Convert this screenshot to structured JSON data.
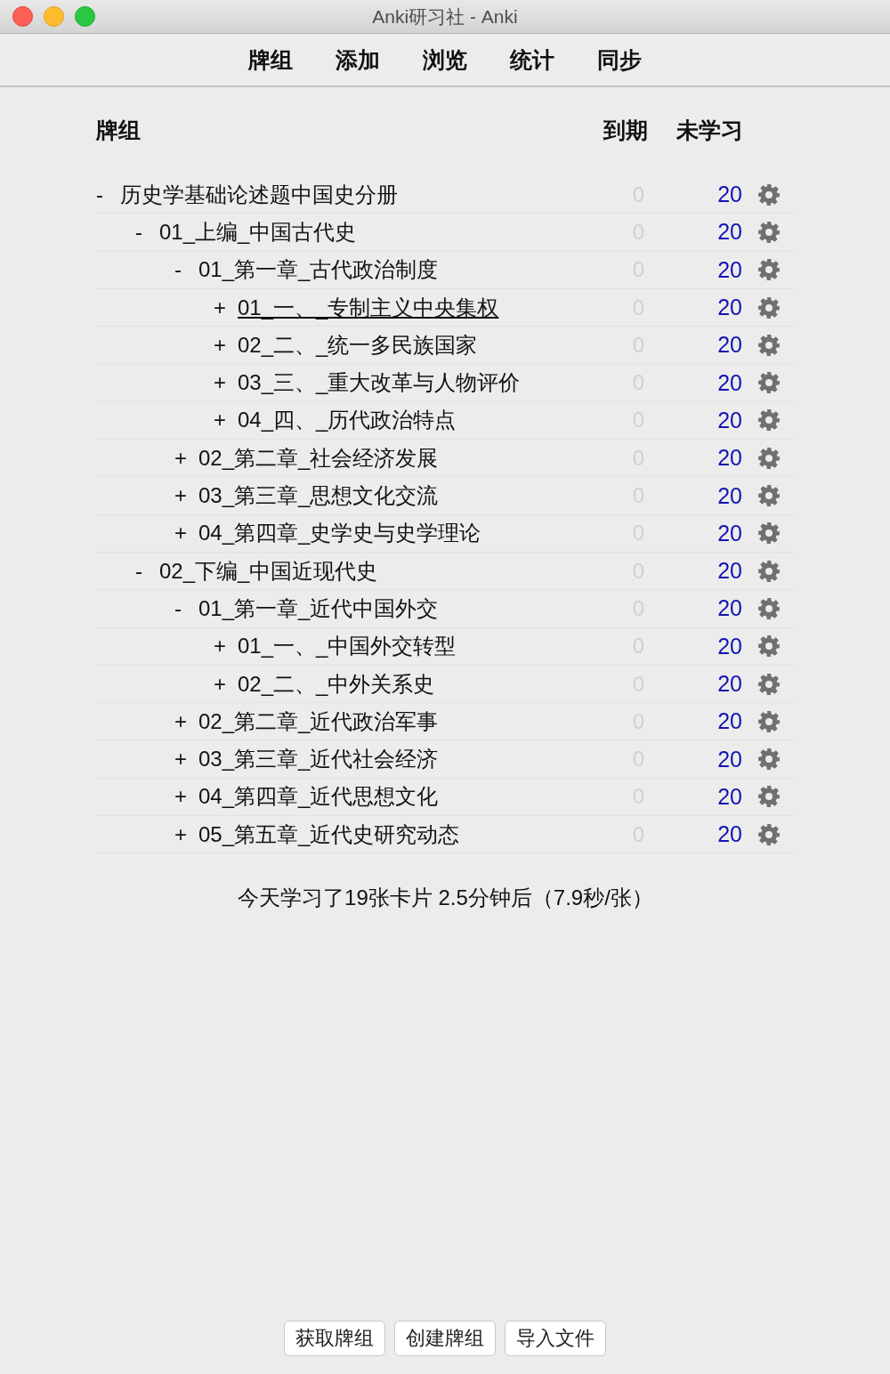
{
  "window": {
    "title": "Anki研习社 - Anki"
  },
  "toolbar": [
    {
      "label": "牌组"
    },
    {
      "label": "添加"
    },
    {
      "label": "浏览"
    },
    {
      "label": "统计"
    },
    {
      "label": "同步"
    }
  ],
  "columns": {
    "deck": "牌组",
    "due": "到期",
    "new": "未学习"
  },
  "decks": [
    {
      "toggle": "-",
      "name": "历史学基础论述题中国史分册",
      "due": "0",
      "new": "20",
      "current": false,
      "children": [
        {
          "toggle": "-",
          "name": "01_上编_中国古代史",
          "due": "0",
          "new": "20",
          "current": false,
          "children": [
            {
              "toggle": "-",
              "name": "01_第一章_古代政治制度",
              "due": "0",
              "new": "20",
              "current": false,
              "children": [
                {
                  "toggle": "+",
                  "name": "01_一、_专制主义中央集权",
                  "due": "0",
                  "new": "20",
                  "current": true
                },
                {
                  "toggle": "+",
                  "name": "02_二、_统一多民族国家",
                  "due": "0",
                  "new": "20",
                  "current": false
                },
                {
                  "toggle": "+",
                  "name": "03_三、_重大改革与人物评价",
                  "due": "0",
                  "new": "20",
                  "current": false
                },
                {
                  "toggle": "+",
                  "name": "04_四、_历代政治特点",
                  "due": "0",
                  "new": "20",
                  "current": false
                }
              ]
            },
            {
              "toggle": "+",
              "name": "02_第二章_社会经济发展",
              "due": "0",
              "new": "20",
              "current": false
            },
            {
              "toggle": "+",
              "name": "03_第三章_思想文化交流",
              "due": "0",
              "new": "20",
              "current": false
            },
            {
              "toggle": "+",
              "name": "04_第四章_史学史与史学理论",
              "due": "0",
              "new": "20",
              "current": false
            }
          ]
        },
        {
          "toggle": "-",
          "name": "02_下编_中国近现代史",
          "due": "0",
          "new": "20",
          "current": false,
          "children": [
            {
              "toggle": "-",
              "name": "01_第一章_近代中国外交",
              "due": "0",
              "new": "20",
              "current": false,
              "children": [
                {
                  "toggle": "+",
                  "name": "01_一、_中国外交转型",
                  "due": "0",
                  "new": "20",
                  "current": false
                },
                {
                  "toggle": "+",
                  "name": "02_二、_中外关系史",
                  "due": "0",
                  "new": "20",
                  "current": false
                }
              ]
            },
            {
              "toggle": "+",
              "name": "02_第二章_近代政治军事",
              "due": "0",
              "new": "20",
              "current": false
            },
            {
              "toggle": "+",
              "name": "03_第三章_近代社会经济",
              "due": "0",
              "new": "20",
              "current": false
            },
            {
              "toggle": "+",
              "name": "04_第四章_近代思想文化",
              "due": "0",
              "new": "20",
              "current": false
            },
            {
              "toggle": "+",
              "name": "05_第五章_近代史研究动态",
              "due": "0",
              "new": "20",
              "current": false
            }
          ]
        }
      ]
    }
  ],
  "summary": "今天学习了19张卡片 2.5分钟后（7.9秒/张）",
  "buttons": [
    {
      "label": "获取牌组"
    },
    {
      "label": "创建牌组"
    },
    {
      "label": "导入文件"
    }
  ]
}
